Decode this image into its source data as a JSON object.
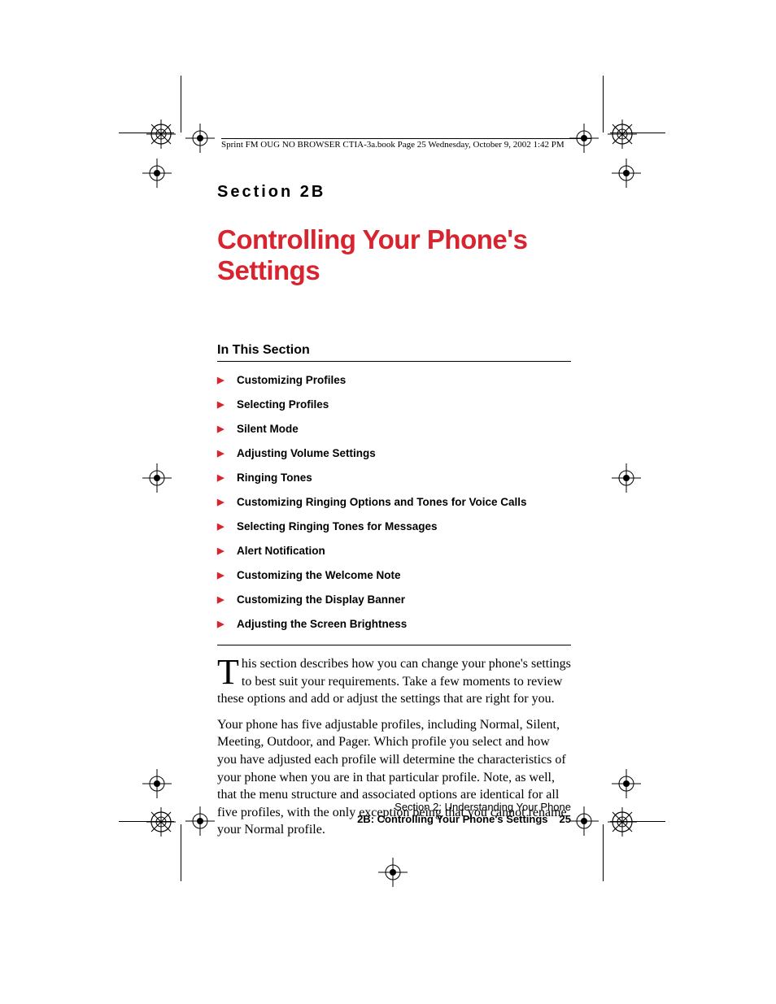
{
  "running_header": "Sprint FM OUG NO BROWSER CTIA-3a.book  Page 25  Wednesday, October 9, 2002  1:42 PM",
  "section_label": "Section 2B",
  "title": "Controlling Your Phone's Settings",
  "subhead": "In This Section",
  "toc": [
    "Customizing Profiles",
    "Selecting Profiles",
    "Silent Mode",
    "Adjusting Volume Settings",
    "Ringing Tones",
    "Customizing Ringing Options and Tones for Voice Calls",
    "Selecting Ringing Tones for Messages",
    "Alert Notification",
    "Customizing the Welcome Note",
    "Customizing the Display Banner",
    "Adjusting the Screen Brightness"
  ],
  "dropcap": "T",
  "para1_rest": "his section describes how you can change your phone's settings to best suit your requirements. Take a few moments to review these options and add or adjust the settings that are right for you.",
  "para2": "Your phone has five adjustable profiles, including Normal, Silent, Meeting, Outdoor, and Pager. Which profile you select and how you have adjusted each profile will determine the characteristics of your phone when you are in that particular profile. Note, as well, that the menu structure and associated options are identical for all five profiles, with the only exception being that you cannot rename your Normal profile.",
  "footer_line1": "Section 2: Understanding Your Phone",
  "footer_line2": "2B: Controlling Your Phone's Settings",
  "footer_page": "25",
  "colors": {
    "accent": "#d8242f"
  }
}
